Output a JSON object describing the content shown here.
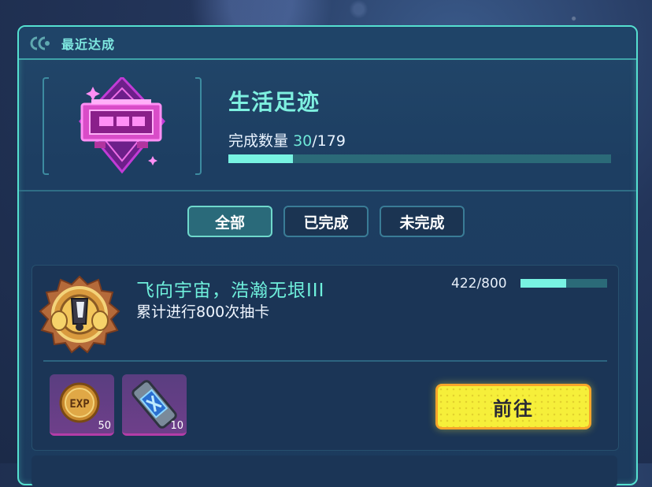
{
  "header": {
    "title": "最近达成",
    "icon": "achievement-logo-icon"
  },
  "category": {
    "title": "生活足迹",
    "count_label": "完成数量",
    "count_current": "30",
    "count_total": "/179",
    "progress": 0.168,
    "badge_icon": "radio-badge-icon"
  },
  "tabs": [
    {
      "label": "全部",
      "active": true
    },
    {
      "label": "已完成",
      "active": false
    },
    {
      "label": "未完成",
      "active": false
    }
  ],
  "achievement": {
    "title": "飞向宇宙，浩瀚无垠III",
    "description": "累计进行800次抽卡",
    "progress_text": "422/800",
    "progress": 0.5275,
    "medal_icon": "gold-medal-icon",
    "rewards": [
      {
        "icon": "exp-coin-icon",
        "count": "50"
      },
      {
        "icon": "ticket-icon",
        "count": "10"
      }
    ],
    "go_label": "前往"
  },
  "colors": {
    "accent": "#55e0d0",
    "button": "#f6ef3a",
    "panel": "#1f4468"
  }
}
